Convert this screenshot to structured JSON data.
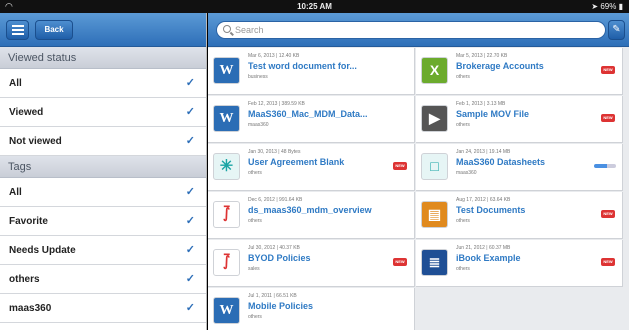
{
  "status_bar": {
    "time": "10:25 AM",
    "battery": "69%"
  },
  "sidebar": {
    "back_label": "Back",
    "viewed_header": "Viewed status",
    "viewed_items": [
      {
        "label": "All",
        "checked": true
      },
      {
        "label": "Viewed",
        "checked": true
      },
      {
        "label": "Not viewed",
        "checked": true
      }
    ],
    "tags_header": "Tags",
    "tag_items": [
      {
        "label": "All",
        "checked": true
      },
      {
        "label": "Favorite",
        "checked": true
      },
      {
        "label": "Needs Update",
        "checked": true
      },
      {
        "label": "others",
        "checked": true
      },
      {
        "label": "maas360",
        "checked": true
      }
    ]
  },
  "search": {
    "placeholder": "Search"
  },
  "documents": [
    {
      "meta": "Mar 6, 2013 | 12.40 KB",
      "title": "Test word document for...",
      "tag": "business",
      "icon": "word-icon",
      "new": false
    },
    {
      "meta": "Mar 5, 2013 | 22.70 KB",
      "title": "Brokerage Accounts",
      "tag": "others",
      "icon": "excel-icon",
      "new": true
    },
    {
      "meta": "Feb 12, 2013 | 389.59 KB",
      "title": "MaaS360_Mac_MDM_Data...",
      "tag": "maas360",
      "icon": "word-icon",
      "new": false
    },
    {
      "meta": "Feb 1, 2013 | 3.13 MB",
      "title": "Sample MOV File",
      "tag": "others",
      "icon": "video-icon",
      "new": true
    },
    {
      "meta": "Jan 30, 2013 | 48 Bytes",
      "title": "User Agreement Blank",
      "tag": "others",
      "icon": "agreement-icon",
      "new": true
    },
    {
      "meta": "Jan 24, 2013 | 19.14 MB",
      "title": "MaaS360 Datasheets",
      "tag": "maas360",
      "icon": "document-icon",
      "new": false,
      "downloading": true
    },
    {
      "meta": "Dec 6, 2012 | 991.64 KB",
      "title": "ds_maas360_mdm_overview",
      "tag": "others",
      "icon": "pdf-icon",
      "new": false
    },
    {
      "meta": "Aug 17, 2012 | 63.64 KB",
      "title": "Test Documents",
      "tag": "others",
      "icon": "presentation-icon",
      "new": true
    },
    {
      "meta": "Jul 30, 2012 | 40.37 KB",
      "title": "BYOD Policies",
      "tag": "sales",
      "icon": "pdf-icon",
      "new": true
    },
    {
      "meta": "Jun 21, 2012 | 60.37 MB",
      "title": "iBook Example",
      "tag": "others",
      "icon": "ibook-icon",
      "new": true
    },
    {
      "meta": "Jul 1, 2011 | 66.51 KB",
      "title": "Mobile Policies",
      "tag": "others",
      "icon": "word-icon",
      "new": false
    }
  ],
  "badge_new": "NEW",
  "colors": {
    "toolbar": "#2e6fb8",
    "title_link": "#2f7ac4",
    "new_badge": "#dd3333"
  }
}
